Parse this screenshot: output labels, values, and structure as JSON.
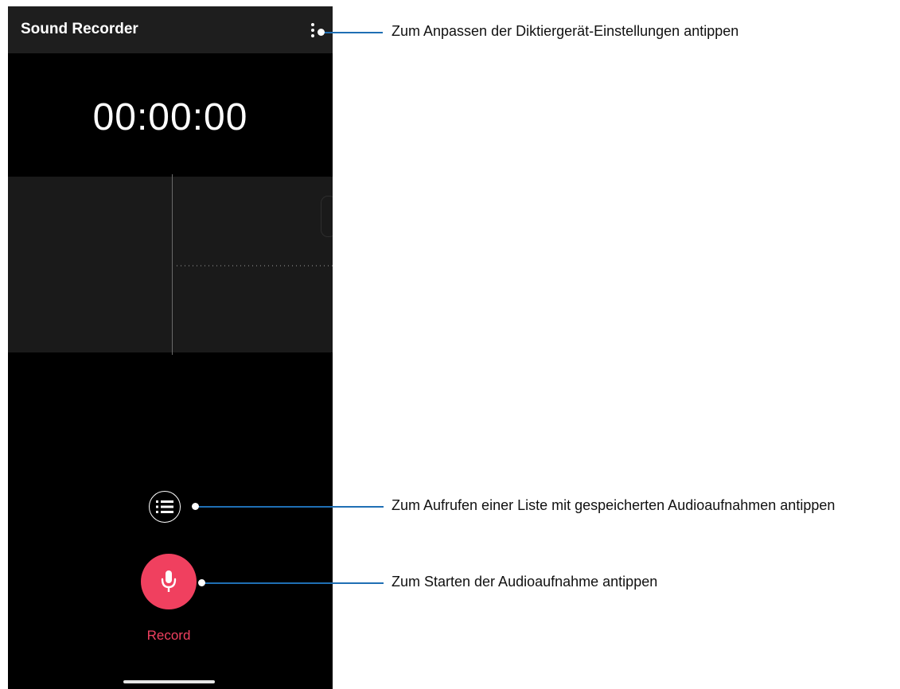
{
  "app": {
    "title": "Sound Recorder",
    "timer": "00:00:00",
    "record_label": "Record"
  },
  "icons": {
    "menu": "more-vert-icon",
    "list": "list-icon",
    "record": "microphone-icon"
  },
  "callouts": [
    {
      "text": "Zum Anpassen der Diktiergerät-Einstellungen antippen"
    },
    {
      "text": "Zum Aufrufen einer Liste mit gespeicherten Audioaufnahmen antippen"
    },
    {
      "text": "Zum Starten der Audioaufnahme antippen"
    }
  ],
  "colors": {
    "accent": "#f0405f",
    "leader_line": "#1f6fb4",
    "app_bar": "#1e1e1e",
    "screen_bg": "#000000"
  }
}
